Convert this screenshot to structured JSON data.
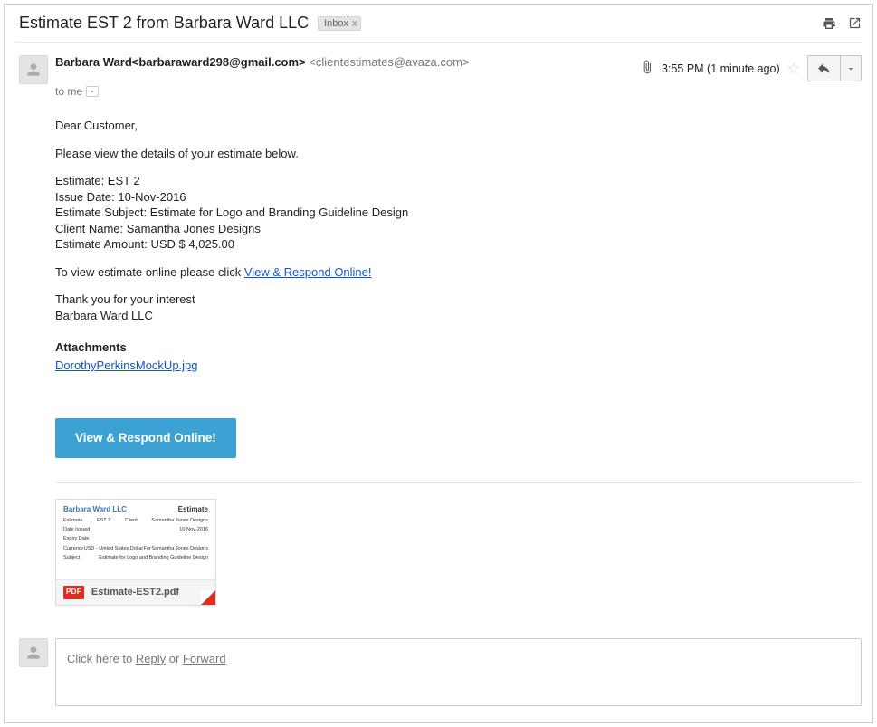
{
  "subject": "Estimate EST 2 from Barbara Ward LLC",
  "tag": {
    "label": "Inbox",
    "close": "x"
  },
  "from": {
    "display": "Barbara Ward<barbaraward298@gmail.com>",
    "via": " <clientestimates@avaza.com>"
  },
  "timestamp": "3:55 PM (1 minute ago)",
  "to": {
    "label": "to me"
  },
  "body": {
    "greeting": "Dear Customer,",
    "intro": "Please view the details of your estimate below.",
    "lines": {
      "estimate": "Estimate: EST 2",
      "issue": "Issue Date: 10-Nov-2016",
      "subj": "Estimate Subject: Estimate for Logo and Branding Guideline Design",
      "client": "Client Name: Samantha Jones Designs",
      "amount": "Estimate Amount: USD $ 4,025.00"
    },
    "view_prefix": "To view estimate online please click ",
    "view_link": "View & Respond Online!",
    "thanks": "Thank you for your interest",
    "signature": "Barbara Ward LLC",
    "attachments_heading": "Attachments",
    "attachment_link": "DorothyPerkinsMockUp.jpg",
    "cta": "View & Respond Online!"
  },
  "attachment_card": {
    "preview_company": "Barbara Ward LLC",
    "preview_title": "Estimate",
    "filename": "Estimate-EST2.pdf",
    "badge": "PDF"
  },
  "reply": {
    "prefix": "Click here to ",
    "reply": "Reply",
    "or": " or ",
    "forward": "Forward"
  }
}
